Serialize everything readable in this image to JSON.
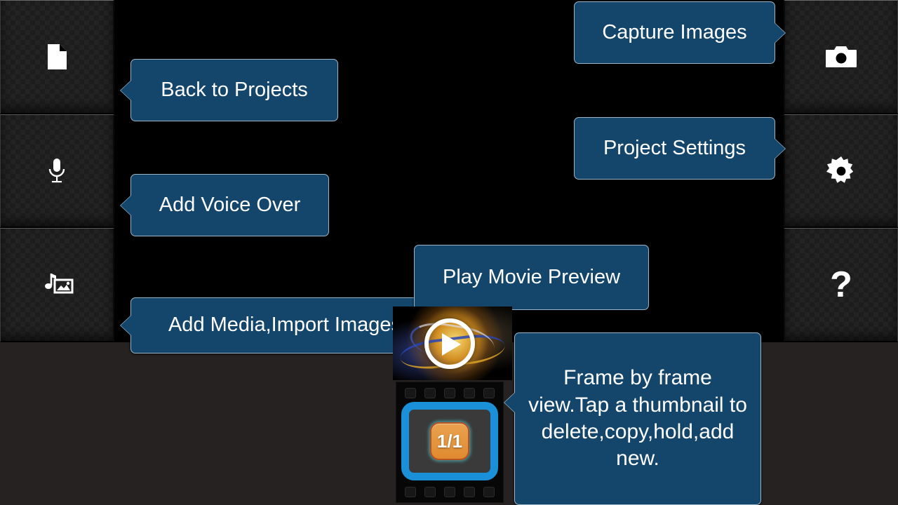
{
  "app": {
    "background_color": "#000000",
    "bottom_panel_color": "#262221",
    "accent_blue": "#14456b",
    "selection_blue": "#1a90d9",
    "badge_orange": "#e9a24f"
  },
  "left_rail": {
    "buttons": [
      {
        "icon": "document-icon",
        "name": "projects-button"
      },
      {
        "icon": "microphone-icon",
        "name": "voice-over-button"
      },
      {
        "icon": "music-image-icon",
        "name": "add-media-button"
      }
    ]
  },
  "right_rail": {
    "buttons": [
      {
        "icon": "camera-icon",
        "name": "capture-images-button"
      },
      {
        "icon": "gear-icon",
        "name": "project-settings-button"
      },
      {
        "icon": "question-mark-icon",
        "name": "help-button",
        "glyph": "?"
      }
    ]
  },
  "callouts": {
    "back_to_projects": "Back to Projects",
    "add_voice_over": "Add Voice Over",
    "add_media": "Add Media,Import Images",
    "capture_images": "Capture Images",
    "project_settings": "Project Settings",
    "play_movie_preview": "Play Movie Preview",
    "frame_by_frame": "Frame by frame view.Tap a thumbnail to delete,copy,hold,add new."
  },
  "preview": {
    "play_button_label": "play-movie-preview",
    "logo_alt": "app-logo"
  },
  "filmstrip": {
    "frame_count_label": "1/1",
    "sprocket_count": 5
  }
}
